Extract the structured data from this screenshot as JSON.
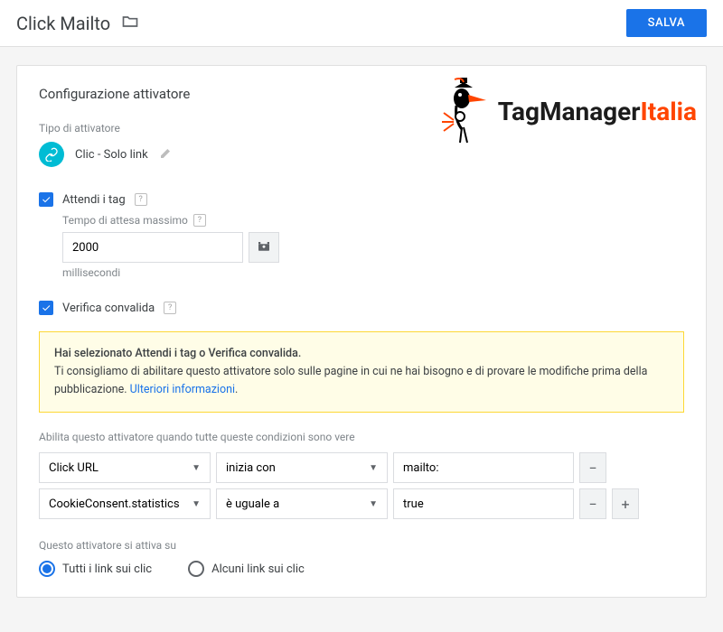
{
  "header": {
    "title": "Click Mailto",
    "save_label": "SALVA"
  },
  "config": {
    "section_title": "Configurazione attivatore",
    "type_label": "Tipo di attivatore",
    "type_name": "Clic - Solo link",
    "wait": {
      "label": "Attendi i tag",
      "max_label": "Tempo di attesa massimo",
      "value": "2000",
      "unit": "millisecondi"
    },
    "validate": {
      "label": "Verifica convalida"
    },
    "notice": {
      "bold": "Hai selezionato Attendi i tag o Verifica convalida.",
      "body": "Ti consigliamo di abilitare questo attivatore solo sulle pagine in cui ne hai bisogno e di provare le modifiche prima della pubblicazione. ",
      "link": "Ulteriori informazioni"
    },
    "conditions": {
      "label": "Abilita questo attivatore quando tutte queste condizioni sono vere",
      "rows": [
        {
          "var": "Click URL",
          "op": "inizia con",
          "val": "mailto:"
        },
        {
          "var": "CookieConsent.statistics",
          "op": "è uguale a",
          "val": "true"
        }
      ]
    },
    "fires": {
      "label": "Questo attivatore si attiva su",
      "all": "Tutti i link sui clic",
      "some": "Alcuni link sui clic"
    }
  },
  "watermark": {
    "t1": "TagManager",
    "t2": "Italia"
  }
}
